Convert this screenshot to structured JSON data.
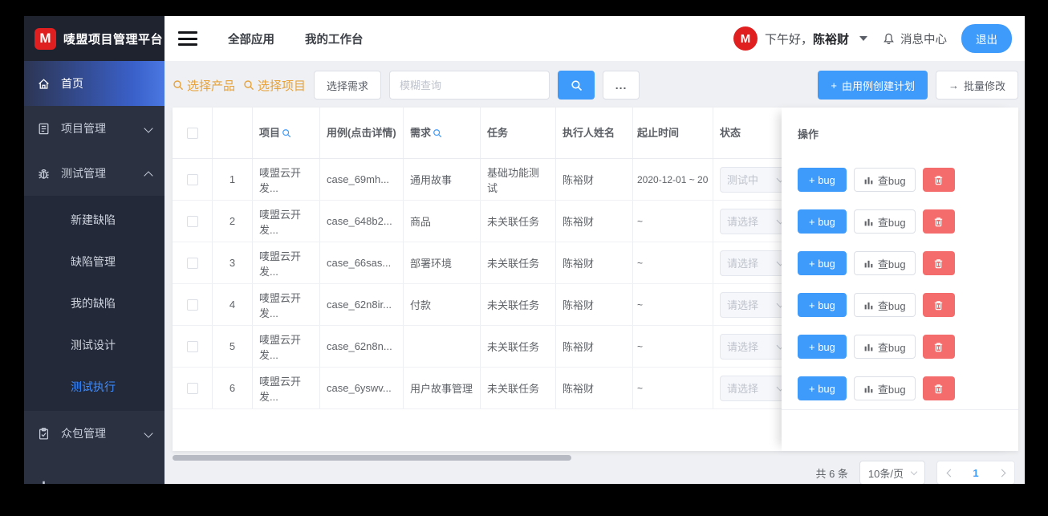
{
  "colors": {
    "accent": "#3f9bfb",
    "danger": "#f56c6c",
    "link_orange": "#e6a23c",
    "logo_red": "#e02020",
    "sidebar_bg": "#2b3141"
  },
  "header": {
    "logo_letter": "M",
    "app_title": "唛盟项目管理平台",
    "nav_all_apps": "全部应用",
    "nav_workbench": "我的工作台",
    "avatar_letter": "M",
    "greeting_prefix": "下午好，",
    "user_name": "陈裕财",
    "message_center": "消息中心",
    "logout": "退出"
  },
  "sidebar": {
    "home": "首页",
    "project_mgmt": "项目管理",
    "test_mgmt": "测试管理",
    "submenu": [
      "新建缺陷",
      "缺陷管理",
      "我的缺陷",
      "测试设计",
      "测试执行"
    ],
    "crowd_mgmt": "众包管理"
  },
  "toolbar": {
    "select_product": "选择产品",
    "select_project": "选择项目",
    "select_requirement": "选择需求",
    "search_placeholder": "模糊查询",
    "more": "...",
    "create_plan_plus": "+",
    "create_plan": "由用例创建计划",
    "batch_edit_arrow": "→",
    "batch_edit": "批量修改"
  },
  "table": {
    "col_project": "项目",
    "col_case": "用例(点击详情)",
    "col_req": "需求",
    "col_task": "任务",
    "col_exec": "执行人姓名",
    "col_time": "起止时间",
    "col_status": "状态",
    "col_ops": "操作",
    "rows": [
      {
        "no": "1",
        "project": "唛盟云开发...",
        "case_id": "case_69mh...",
        "req": "通用故事",
        "task": "基础功能测试",
        "exec": "陈裕财",
        "time": "2020-12-01 ~ 20",
        "status": "测试中"
      },
      {
        "no": "2",
        "project": "唛盟云开发...",
        "case_id": "case_648b2...",
        "req": "商品",
        "task": "未关联任务",
        "exec": "陈裕财",
        "time": "~",
        "status": "请选择"
      },
      {
        "no": "3",
        "project": "唛盟云开发...",
        "case_id": "case_66sas...",
        "req": "部署环境",
        "task": "未关联任务",
        "exec": "陈裕财",
        "time": "~",
        "status": "请选择"
      },
      {
        "no": "4",
        "project": "唛盟云开发...",
        "case_id": "case_62n8ir...",
        "req": "付款",
        "task": "未关联任务",
        "exec": "陈裕财",
        "time": "~",
        "status": "请选择"
      },
      {
        "no": "5",
        "project": "唛盟云开发...",
        "case_id": "case_62n8n...",
        "req": "",
        "task": "未关联任务",
        "exec": "陈裕财",
        "time": "~",
        "status": "请选择"
      },
      {
        "no": "6",
        "project": "唛盟云开发...",
        "case_id": "case_6yswv...",
        "req": "用户故事管理",
        "task": "未关联任务",
        "exec": "陈裕财",
        "time": "~",
        "status": "请选择"
      }
    ]
  },
  "ops": {
    "add_bug": "+ bug",
    "view_bug": "查bug"
  },
  "pagination": {
    "total": "共 6 条",
    "page_size": "10条/页",
    "current_page": "1"
  }
}
